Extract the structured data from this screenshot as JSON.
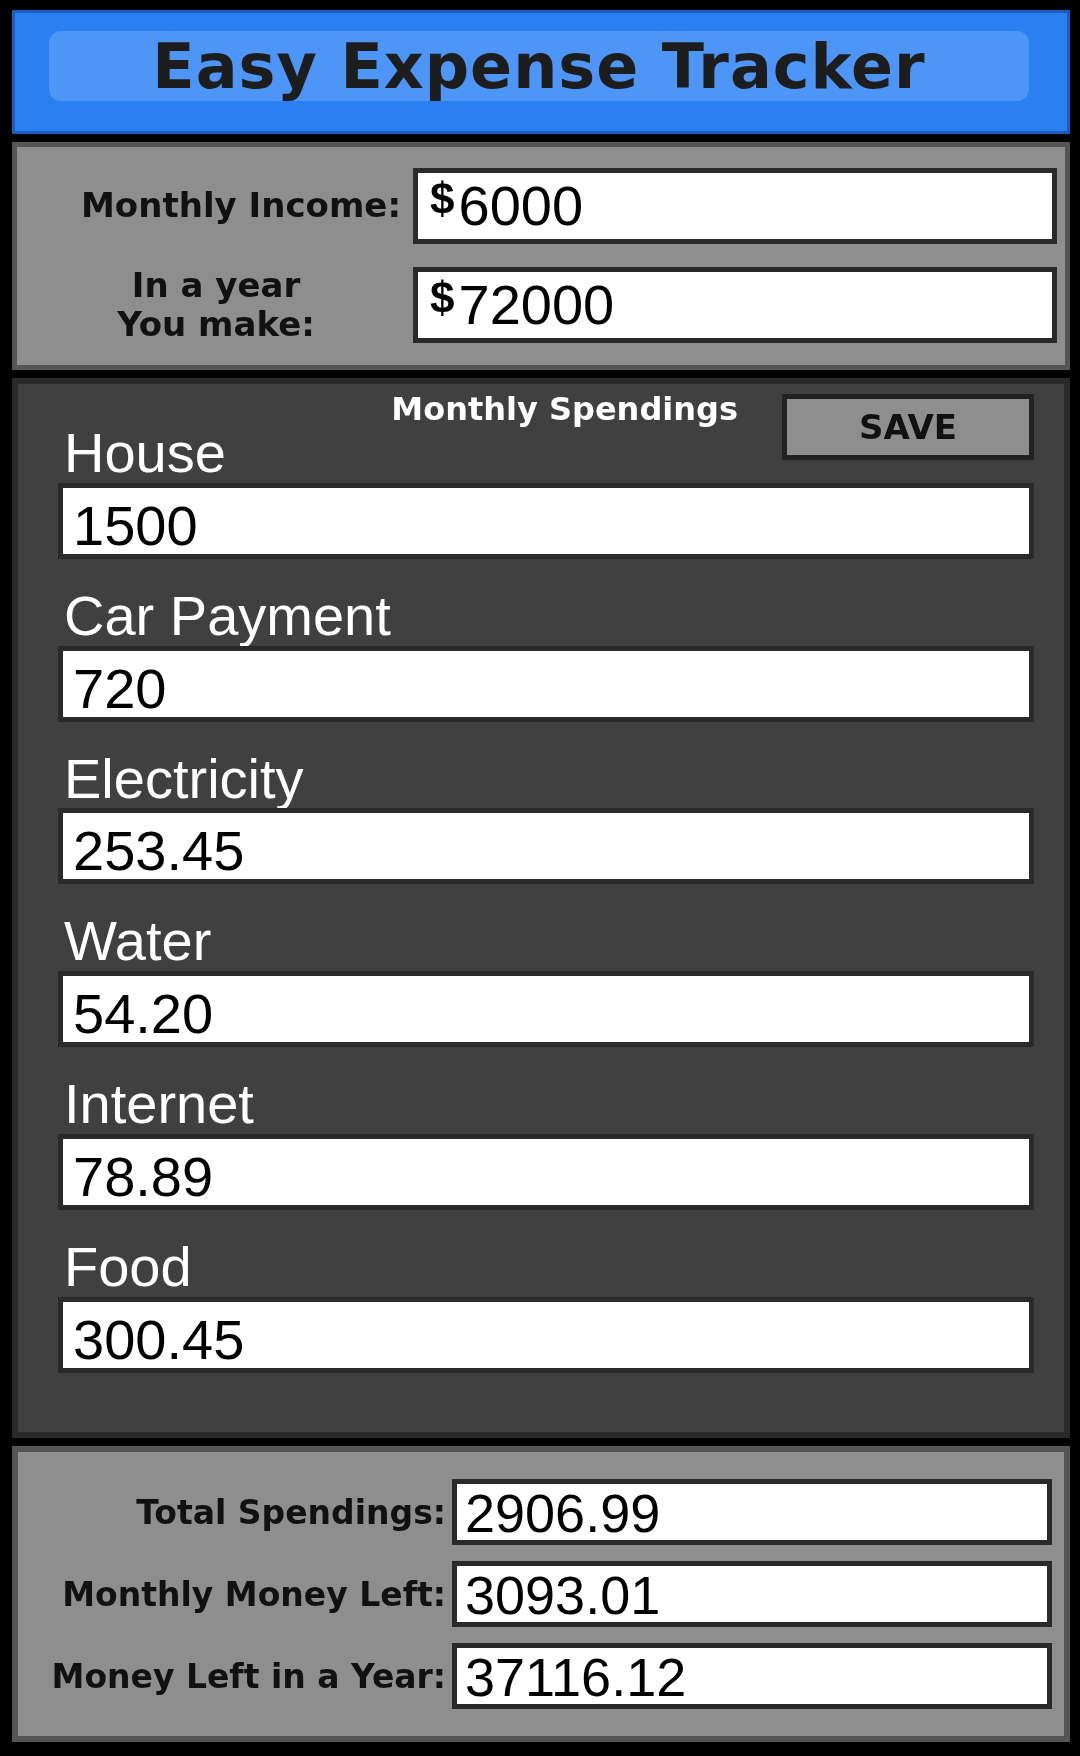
{
  "title": "Easy Expense Tracker",
  "income": {
    "monthly_label": "Monthly Income:",
    "monthly_prefix": "$",
    "monthly_value": "6000",
    "year_label": [
      "In a year",
      "You make:"
    ],
    "year_prefix": "$",
    "year_value": "72000"
  },
  "spendings": {
    "heading": "Monthly Spendings",
    "save_button": "SAVE",
    "items": [
      {
        "label": "House",
        "value": "1500"
      },
      {
        "label": "Car Payment",
        "value": "720"
      },
      {
        "label": "Electricity",
        "value": "253.45"
      },
      {
        "label": "Water",
        "value": "54.20"
      },
      {
        "label": "Internet",
        "value": "78.89"
      },
      {
        "label": "Food",
        "value": "300.45"
      }
    ]
  },
  "summary": [
    {
      "label": "Total Spendings:",
      "value": "2906.99"
    },
    {
      "label": "Monthly Money Left:",
      "value": "3093.01"
    },
    {
      "label": "Money Left in a Year:",
      "value": "37116.12"
    }
  ]
}
